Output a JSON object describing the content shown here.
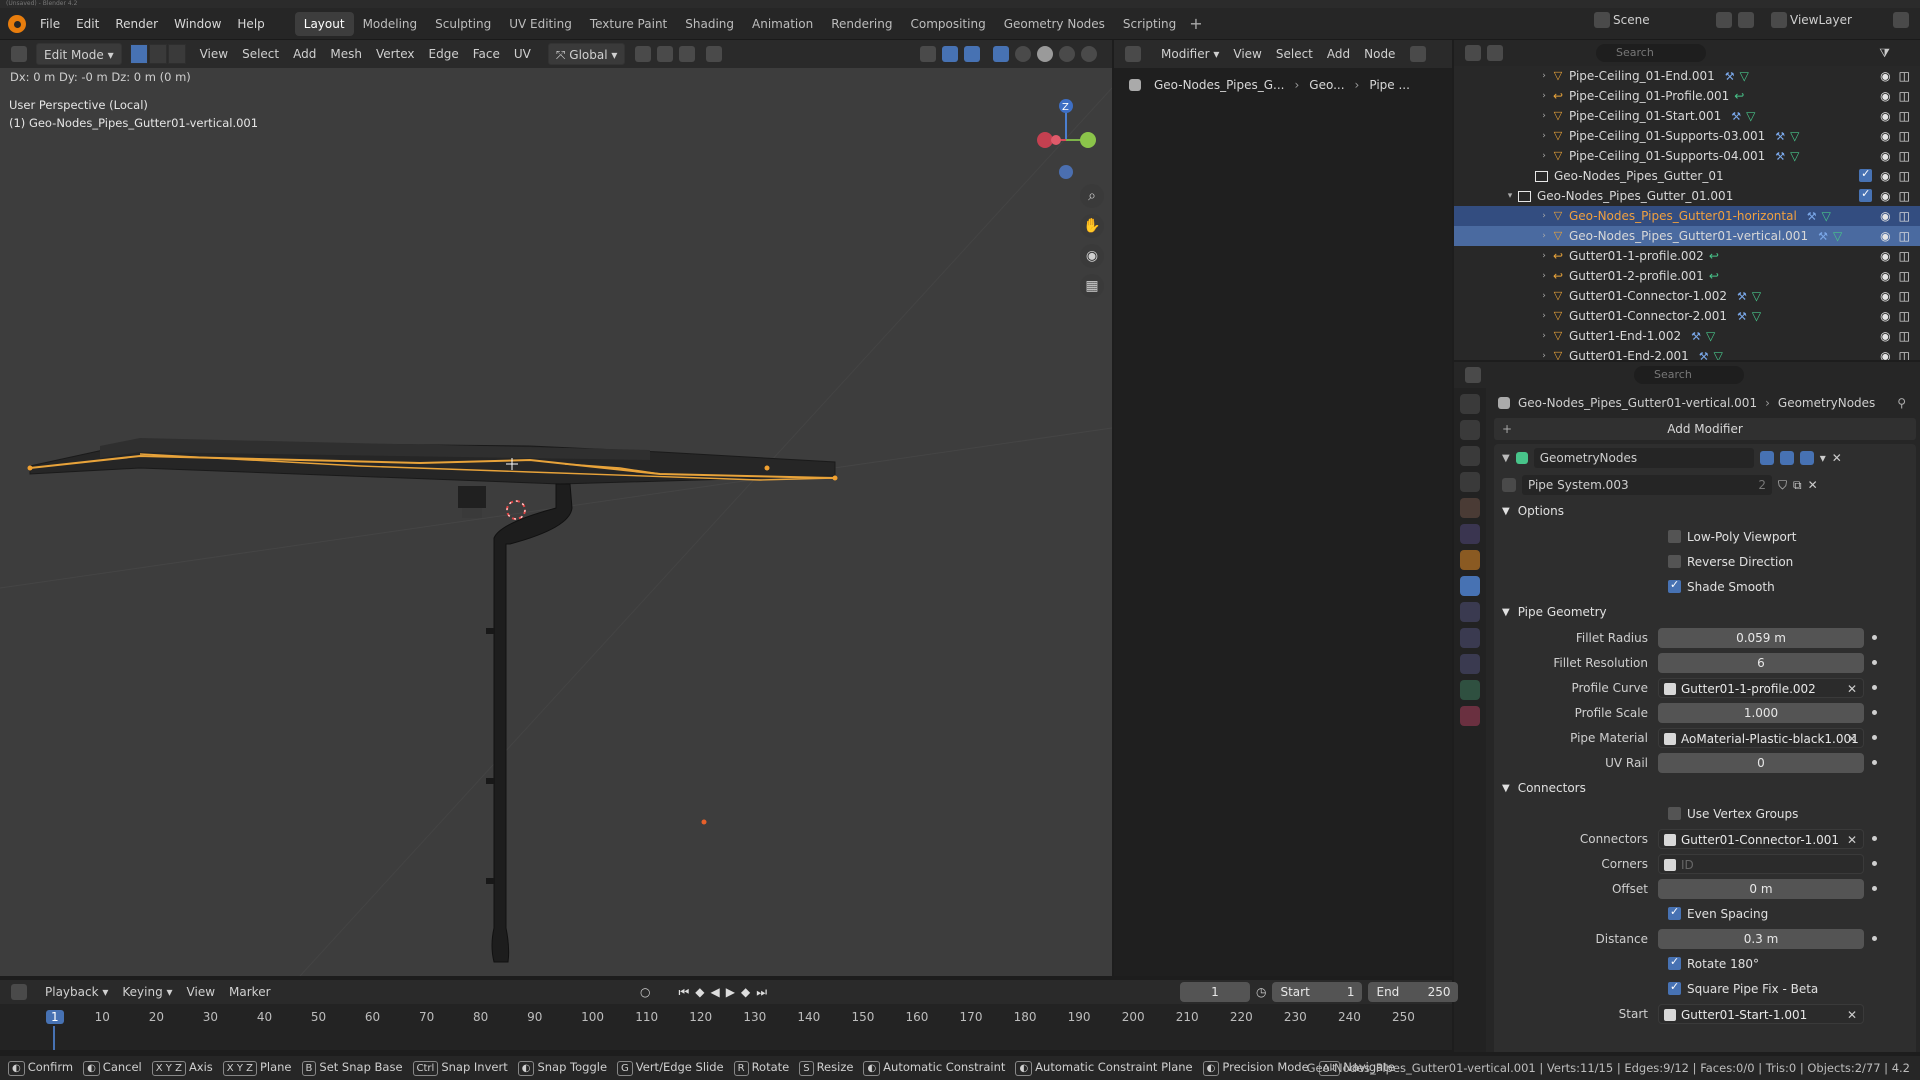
{
  "titlebar": {
    "text": "(Unsaved) - Blender 4.2"
  },
  "menu": [
    "File",
    "Edit",
    "Render",
    "Window",
    "Help"
  ],
  "workspaces": [
    {
      "label": "Layout",
      "active": true
    },
    {
      "label": "Modeling"
    },
    {
      "label": "Sculpting"
    },
    {
      "label": "UV Editing"
    },
    {
      "label": "Texture Paint"
    },
    {
      "label": "Shading"
    },
    {
      "label": "Animation"
    },
    {
      "label": "Rendering"
    },
    {
      "label": "Compositing"
    },
    {
      "label": "Geometry Nodes"
    },
    {
      "label": "Scripting"
    }
  ],
  "topright": {
    "scene": "Scene",
    "viewlayer": "ViewLayer"
  },
  "viewport_header": {
    "mode": "Edit Mode",
    "menus": [
      "View",
      "Select",
      "Add",
      "Mesh",
      "Vertex",
      "Edge",
      "Face",
      "UV"
    ],
    "orientation": "Global"
  },
  "viewport": {
    "perspective": "User Perspective (Local)",
    "object": "(1) Geo-Nodes_Pipes_Gutter01-vertical.001",
    "delta": "Dx: 0 m   Dy: -0 m   Dz: 0 m (0 m)"
  },
  "node_header": {
    "editor": "Modifier",
    "menus": [
      "View",
      "Select",
      "Add",
      "Node"
    ]
  },
  "node_breadcrumb": [
    "Geo-Nodes_Pipes_G...",
    "Geo...",
    "Pipe ..."
  ],
  "outliner": {
    "search_placeholder": "Search",
    "rows": [
      {
        "name": "Pipe-Ceiling_01-End.001",
        "type": "mesh",
        "indent": 3
      },
      {
        "name": "Pipe-Ceiling_01-Profile.001",
        "type": "curve",
        "indent": 3
      },
      {
        "name": "Pipe-Ceiling_01-Start.001",
        "type": "mesh",
        "indent": 3
      },
      {
        "name": "Pipe-Ceiling_01-Supports-03.001",
        "type": "mesh",
        "indent": 3
      },
      {
        "name": "Pipe-Ceiling_01-Supports-04.001",
        "type": "mesh",
        "indent": 3
      },
      {
        "name": "Geo-Nodes_Pipes_Gutter_01",
        "type": "collection",
        "indent": 2
      },
      {
        "name": "Geo-Nodes_Pipes_Gutter_01.001",
        "type": "collection",
        "indent": 1
      },
      {
        "name": "Geo-Nodes_Pipes_Gutter01-horizontal",
        "type": "mesh",
        "indent": 3,
        "state": "sel"
      },
      {
        "name": "Geo-Nodes_Pipes_Gutter01-vertical.001",
        "type": "mesh",
        "indent": 3,
        "state": "act"
      },
      {
        "name": "Gutter01-1-profile.002",
        "type": "curve",
        "indent": 3
      },
      {
        "name": "Gutter01-2-profile.001",
        "type": "curve",
        "indent": 3
      },
      {
        "name": "Gutter01-Connector-1.002",
        "type": "mesh",
        "indent": 3
      },
      {
        "name": "Gutter01-Connector-2.001",
        "type": "mesh",
        "indent": 3
      },
      {
        "name": "Gutter1-End-1.002",
        "type": "mesh",
        "indent": 3
      },
      {
        "name": "Gutter01-End-2.001",
        "type": "mesh",
        "indent": 3
      }
    ]
  },
  "properties": {
    "search_placeholder": "Search",
    "breadcrumb_object": "Geo-Nodes_Pipes_Gutter01-vertical.001",
    "breadcrumb_modifier": "GeometryNodes",
    "add_modifier": "Add Modifier",
    "modifier_name": "GeometryNodes",
    "node_group": "Pipe System.003",
    "node_group_users": "2",
    "sections": {
      "options": "Options",
      "pipe_geometry": "Pipe Geometry",
      "connectors": "Connectors"
    },
    "options": [
      {
        "label": "Low-Poly Viewport",
        "checked": false
      },
      {
        "label": "Reverse Direction",
        "checked": false
      },
      {
        "label": "Shade Smooth",
        "checked": true
      }
    ],
    "pipe_geometry": [
      {
        "label": "Fillet Radius",
        "value": "0.059 m"
      },
      {
        "label": "Fillet Resolution",
        "value": "6"
      },
      {
        "label": "Profile Curve",
        "value": "Gutter01-1-profile.002",
        "ref": true
      },
      {
        "label": "Profile Scale",
        "value": "1.000"
      },
      {
        "label": "Pipe Material",
        "value": "AoMaterial-Plastic-black1.001",
        "ref": true
      },
      {
        "label": "UV Rail",
        "value": "0"
      }
    ],
    "connectors_checkbox": "Use Vertex Groups",
    "connectors": [
      {
        "label": "Connectors",
        "value": "Gutter01-Connector-1.001",
        "ref": true
      },
      {
        "label": "Corners",
        "value": "ID",
        "ref": true,
        "placeholder": true
      },
      {
        "label": "Offset",
        "value": "0 m"
      }
    ],
    "even_spacing": "Even Spacing",
    "distance": {
      "label": "Distance",
      "value": "0.3 m"
    },
    "rotate": "Rotate 180°",
    "square_fix": "Square Pipe Fix - Beta",
    "start": {
      "label": "Start",
      "value": "Gutter01-Start-1.001"
    }
  },
  "timeline": {
    "menus": [
      "Playback",
      "Keying",
      "View",
      "Marker"
    ],
    "current_frame": "1",
    "start_label": "Start",
    "start": "1",
    "end_label": "End",
    "end": "250",
    "ticks": [
      "1",
      "10",
      "20",
      "30",
      "40",
      "50",
      "60",
      "70",
      "80",
      "90",
      "100",
      "110",
      "120",
      "130",
      "140",
      "150",
      "160",
      "170",
      "180",
      "190",
      "200",
      "210",
      "220",
      "230",
      "240",
      "250"
    ]
  },
  "statusbar": {
    "items": [
      {
        "key": "",
        "label": "Confirm"
      },
      {
        "key": "",
        "label": "Cancel"
      },
      {
        "key": "X Y Z",
        "label": "Axis"
      },
      {
        "key": "X Y Z",
        "label": "Plane"
      },
      {
        "key": "B",
        "label": "Set Snap Base"
      },
      {
        "key": "Ctrl",
        "label": "Snap Invert"
      },
      {
        "key": "",
        "label": "Snap Toggle"
      },
      {
        "key": "G",
        "label": "Vert/Edge Slide"
      },
      {
        "key": "R",
        "label": "Rotate"
      },
      {
        "key": "S",
        "label": "Resize"
      },
      {
        "key": "",
        "label": "Automatic Constraint"
      },
      {
        "key": "",
        "label": "Automatic Constraint Plane"
      },
      {
        "key": "",
        "label": "Precision Mode"
      },
      {
        "key": "Alt",
        "label": "Navigate"
      }
    ],
    "stats": "Geo-Nodes_Pipes_Gutter01-vertical.001 | Verts:11/15 | Edges:9/12 | Faces:0/0 | Tris:0 | Objects:2/77 | 4.2"
  },
  "colors": {
    "accent": "#4772b3",
    "selection_orange": "#e8a33a",
    "active_row": "#4a6aa0"
  }
}
